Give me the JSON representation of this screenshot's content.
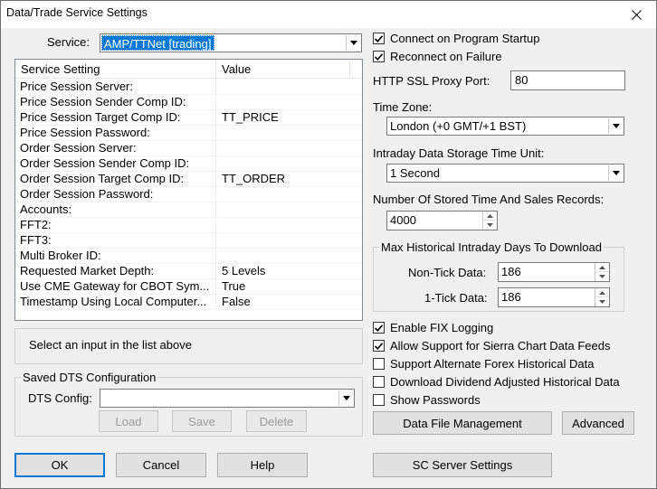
{
  "window": {
    "title": "Data/Trade Service Settings",
    "close_icon": "close-icon"
  },
  "service": {
    "label": "Service:",
    "value": "AMP/TTNet   [trading]"
  },
  "settings_list": {
    "headers": [
      "Service Setting",
      "Value"
    ],
    "rows": [
      {
        "setting": "Price Session Server:",
        "value": ""
      },
      {
        "setting": "Price Session Sender Comp ID:",
        "value": ""
      },
      {
        "setting": "Price Session Target Comp ID:",
        "value": "TT_PRICE"
      },
      {
        "setting": "Price Session Password:",
        "value": ""
      },
      {
        "setting": "Order Session Server:",
        "value": ""
      },
      {
        "setting": "Order Session Sender Comp ID:",
        "value": ""
      },
      {
        "setting": "Order Session Target Comp ID:",
        "value": "TT_ORDER"
      },
      {
        "setting": "Order Session Password:",
        "value": ""
      },
      {
        "setting": "Accounts:",
        "value": ""
      },
      {
        "setting": "FFT2:",
        "value": ""
      },
      {
        "setting": "FFT3:",
        "value": ""
      },
      {
        "setting": "Multi Broker ID:",
        "value": ""
      },
      {
        "setting": "Requested Market Depth:",
        "value": "5 Levels"
      },
      {
        "setting": "Use CME Gateway for CBOT Sym...",
        "value": "True"
      },
      {
        "setting": "Timestamp Using Local Computer...",
        "value": "False"
      }
    ]
  },
  "info_text": "Select an input in the list above",
  "saved_dts": {
    "group_title": "Saved DTS Configuration",
    "config_label": "DTS Config:",
    "config_value": "",
    "load_label": "Load",
    "save_label": "Save",
    "delete_label": "Delete"
  },
  "bottom_buttons": {
    "ok": "OK",
    "cancel": "Cancel",
    "help": "Help",
    "sc_server": "SC Server Settings"
  },
  "right": {
    "connect_startup": {
      "label": "Connect on Program Startup",
      "checked": true
    },
    "reconnect_failure": {
      "label": "Reconnect on Failure",
      "checked": true
    },
    "proxy_port_label": "HTTP SSL Proxy Port:",
    "proxy_port_value": "80",
    "time_zone_label": "Time Zone:",
    "time_zone_value": "London (+0 GMT/+1 BST)",
    "storage_unit_label": "Intraday Data Storage Time Unit:",
    "storage_unit_value": "1 Second",
    "stored_records_label": "Number Of Stored Time And Sales Records:",
    "stored_records_value": "4000",
    "max_hist_title": "Max Historical Intraday Days To Download",
    "non_tick_label": "Non-Tick Data:",
    "non_tick_value": "186",
    "one_tick_label": "1-Tick Data:",
    "one_tick_value": "186",
    "checkboxes": [
      {
        "label": "Enable FIX Logging",
        "checked": true
      },
      {
        "label": "Allow Support for Sierra Chart Data Feeds",
        "checked": true
      },
      {
        "label": "Support Alternate Forex Historical Data",
        "checked": false
      },
      {
        "label": "Download Dividend Adjusted Historical Data",
        "checked": false
      },
      {
        "label": "Show Passwords",
        "checked": false
      }
    ],
    "data_file_mgmt": "Data File Management",
    "advanced": "Advanced"
  }
}
